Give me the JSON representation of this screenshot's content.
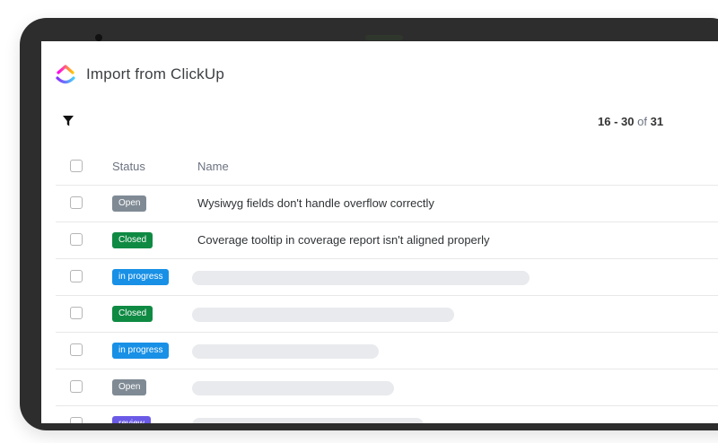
{
  "app": {
    "title": "Import from ClickUp",
    "logo_icon": "clickup-logo-icon"
  },
  "toolbar": {
    "filter_icon": "filter-icon"
  },
  "pagination": {
    "range_start": "16",
    "separator": " - ",
    "range_end": "30",
    "of_label": "of",
    "total": "31"
  },
  "table": {
    "columns": [
      "Status",
      "Name"
    ],
    "rows": [
      {
        "status": "Open",
        "status_color": "#7f8a94",
        "name": "Wysiwyg fields don't handle overflow correctly"
      },
      {
        "status": "Closed",
        "status_color": "#0f8a43",
        "name": "Coverage tooltip in coverage report isn't aligned properly"
      },
      {
        "status": "in progress",
        "status_color": "#1890e6",
        "name": "",
        "placeholder_fraction": 0.5
      },
      {
        "status": "Closed",
        "status_color": "#0f8a43",
        "name": "",
        "placeholder_fraction": 0.35
      },
      {
        "status": "in progress",
        "status_color": "#1890e6",
        "name": "",
        "placeholder_fraction": 0.2
      },
      {
        "status": "Open",
        "status_color": "#7f8a94",
        "name": "",
        "placeholder_fraction": 0.23
      },
      {
        "status": "review",
        "status_color": "#6a5ae6",
        "name": "",
        "placeholder_fraction": 0.29
      }
    ]
  }
}
